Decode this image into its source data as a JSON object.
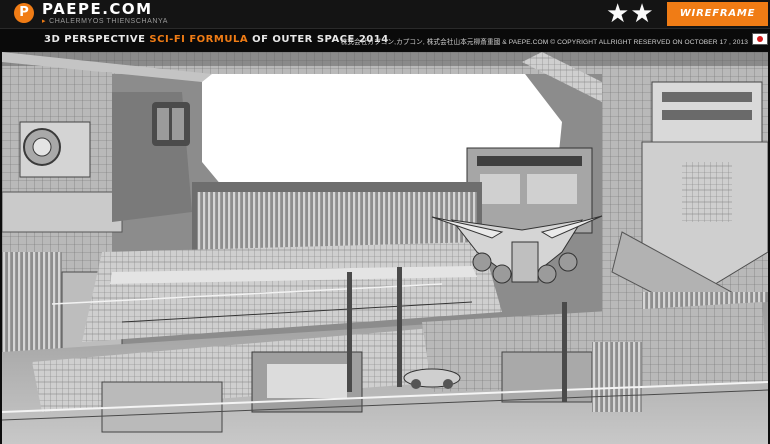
{
  "header": {
    "logo_glyph": "P",
    "brand": "PAEPE.COM",
    "author_caret": "▸",
    "author": "CHALERMYOS THIENSCHANYA",
    "star_glyph": "★",
    "rating_stars": 2,
    "wireframe_label": "WIREFRAME"
  },
  "subheader": {
    "title_part1": "3D PERSPECTIVE",
    "title_accent": "SCI-FI FORMULA",
    "title_part2": "OF OUTER SPACE 2014",
    "copyright": "株式会社カプコン,カプコン, 株式会社山本元柳斎重國 & PAEPE.COM © COPYRIGHT ALLRIGHT RESERVED ON OCTOBER 17 , 2013",
    "flag": "japan-flag-icon"
  },
  "render": {
    "description_icon": "sci-fi-station-render",
    "colors": {
      "accent": "#f07c15",
      "sky": "#ffffff",
      "metal_light": "#d8d8d8",
      "metal_dark": "#3a3a3a"
    }
  }
}
